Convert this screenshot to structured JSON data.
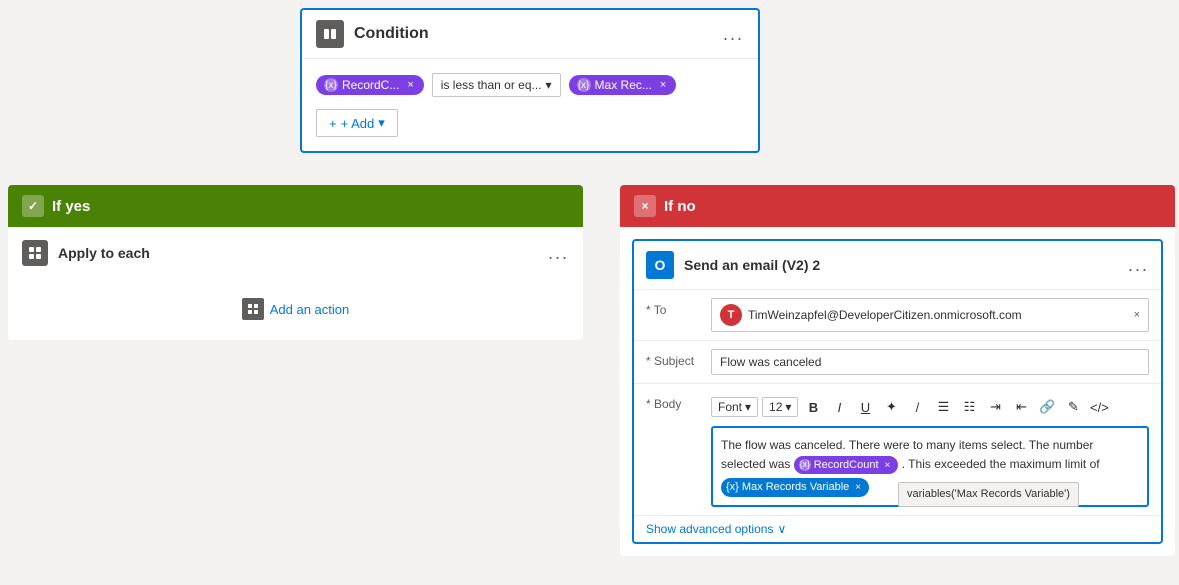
{
  "condition_card": {
    "title": "Condition",
    "icon_label": "condition-icon",
    "more_btn": "...",
    "token1": {
      "label": "RecordC...",
      "close": "×"
    },
    "operator": "is less than or eq...",
    "token2": {
      "label": "Max Rec...",
      "close": "×"
    },
    "add_btn": "+ Add"
  },
  "if_yes": {
    "header_label": "If yes",
    "check_icon": "✓"
  },
  "apply_to_each": {
    "title": "Apply to each",
    "more_btn": "...",
    "add_action_label": "Add an action"
  },
  "if_no": {
    "header_label": "If no",
    "x_icon": "×"
  },
  "send_email": {
    "title": "Send an email (V2) 2",
    "more_btn": "...",
    "outlook_icon": "O",
    "to_label": "* To",
    "to_email": "TimWeinzapfel@DeveloperCitizen.onmicrosoft.com",
    "to_close": "×",
    "to_avatar": "T",
    "subject_label": "* Subject",
    "subject_value": "Flow was canceled",
    "body_label": "* Body",
    "font_label": "Font",
    "font_size": "12",
    "toolbar_buttons": [
      "B",
      "I",
      "U",
      "✦",
      "/",
      "☰",
      "☰",
      "☰",
      "☰",
      "🔗",
      "✎",
      "</>"
    ],
    "body_text_before": "The flow was canceled. There were to many items select. The number selected was",
    "body_token1_label": "RecordCount",
    "body_token1_close": "×",
    "body_text_after": ". This exceeded the maximum limit of",
    "body_token2_label": "Max Records Variable",
    "body_token2_close": "×",
    "tooltip_text": "variables('Max Records Variable')",
    "show_advanced": "Show advanced options",
    "chevron_down": "∨"
  }
}
